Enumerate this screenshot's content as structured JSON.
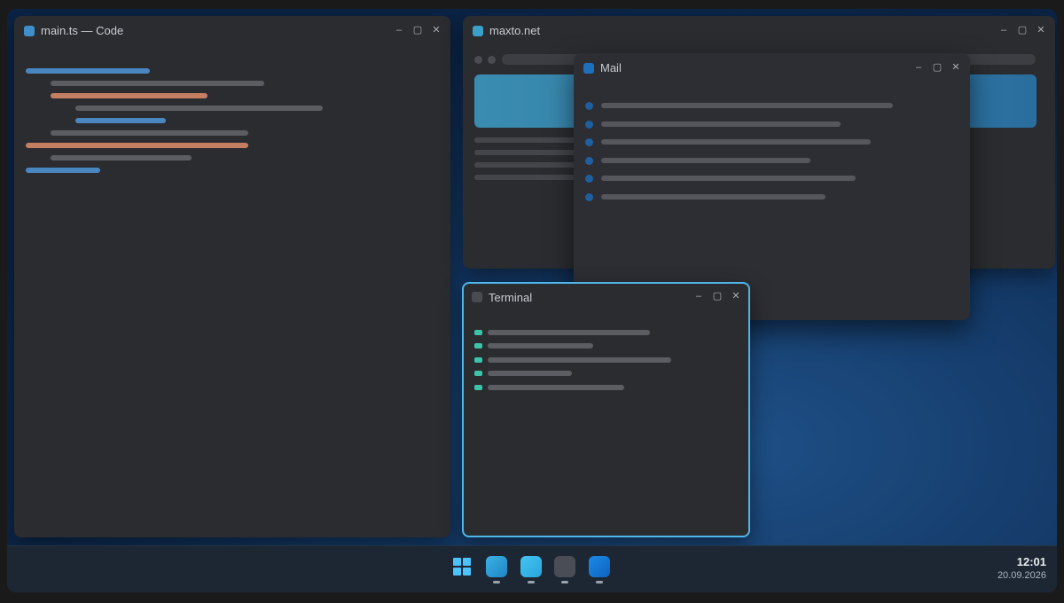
{
  "windows": {
    "code": {
      "title": "main.ts — Code"
    },
    "browser": {
      "title": "maxto.net"
    },
    "mail": {
      "title": "Mail"
    },
    "terminal": {
      "title": "Terminal"
    }
  },
  "window_controls": {
    "minimize": "–",
    "maximize": "▢",
    "close": "✕"
  },
  "taskbar": {
    "icons": [
      {
        "name": "start-icon"
      },
      {
        "name": "code-app-icon",
        "color": "#2f9ed8"
      },
      {
        "name": "browser-app-icon",
        "color": "#38b6ea"
      },
      {
        "name": "terminal-app-icon",
        "color": "#4a4d55"
      },
      {
        "name": "mail-app-icon",
        "color": "#1477d4"
      }
    ],
    "clock": {
      "time": "12:01",
      "date": "20.09.2026"
    }
  },
  "colors": {
    "accent": "#4fb6ea",
    "code_keyword": "#4a86c0",
    "code_string": "#c47e62",
    "terminal_prompt": "#3cc4a8"
  }
}
